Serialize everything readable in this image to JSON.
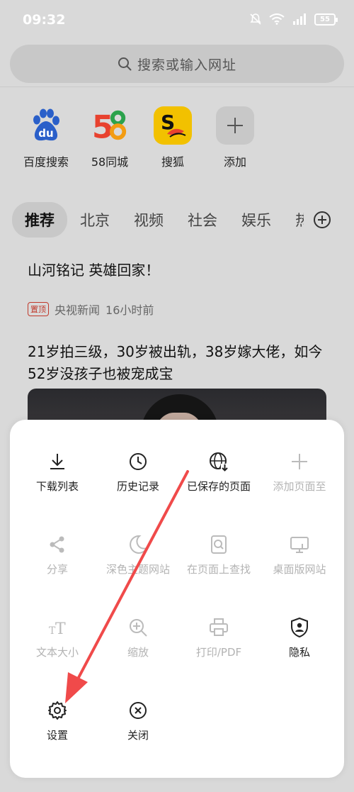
{
  "status_bar": {
    "time": "09:32",
    "battery": "55"
  },
  "search": {
    "placeholder": "搜索或输入网址"
  },
  "shortcuts": [
    {
      "label": "百度搜索",
      "icon": "baidu-icon"
    },
    {
      "label": "58同城",
      "icon": "58-icon"
    },
    {
      "label": "搜狐",
      "icon": "sohu-icon"
    },
    {
      "label": "添加",
      "icon": "plus-icon"
    }
  ],
  "tabs": [
    "推荐",
    "北京",
    "视频",
    "社会",
    "娱乐",
    "热"
  ],
  "feed": {
    "item1_title": "山河铭记 英雄回家！",
    "item1_badge": "置顶",
    "item1_source": "央视新闻",
    "item1_time": "16小时前",
    "item2_title": "21岁拍三级，30岁被出轨，38岁嫁大佬，如今52岁没孩子也被宠成宝"
  },
  "menu": {
    "items": [
      {
        "label": "下载列表",
        "enabled": true,
        "icon": "download-icon"
      },
      {
        "label": "历史记录",
        "enabled": true,
        "icon": "clock-icon"
      },
      {
        "label": "已保存的页面",
        "enabled": true,
        "icon": "globe-download-icon"
      },
      {
        "label": "添加页面至",
        "enabled": false,
        "icon": "plus-icon"
      },
      {
        "label": "分享",
        "enabled": false,
        "icon": "share-icon"
      },
      {
        "label": "深色主题网站",
        "enabled": false,
        "icon": "moon-icon"
      },
      {
        "label": "在页面上查找",
        "enabled": false,
        "icon": "find-in-page-icon"
      },
      {
        "label": "桌面版网站",
        "enabled": false,
        "icon": "desktop-icon"
      },
      {
        "label": "文本大小",
        "enabled": false,
        "icon": "text-size-icon"
      },
      {
        "label": "缩放",
        "enabled": false,
        "icon": "zoom-icon"
      },
      {
        "label": "打印/PDF",
        "enabled": false,
        "icon": "printer-icon"
      },
      {
        "label": "隐私",
        "enabled": true,
        "icon": "privacy-shield-icon"
      },
      {
        "label": "设置",
        "enabled": true,
        "icon": "gear-icon"
      },
      {
        "label": "关闭",
        "enabled": true,
        "icon": "close-circle-icon"
      }
    ]
  },
  "colors": {
    "accent_arrow": "#f04a4a",
    "disabled_text": "#b3b3b3",
    "sheet_bg": "#ffffff"
  }
}
